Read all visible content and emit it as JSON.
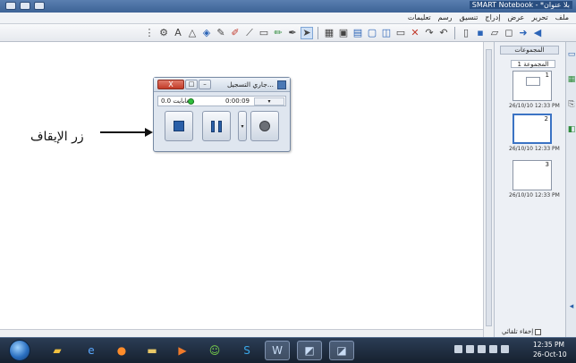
{
  "window": {
    "title": "SMART Notebook - *بلا عنوان"
  },
  "menu": {
    "items": [
      "ملف",
      "تحرير",
      "عرض",
      "إدراج",
      "تنسيق",
      "رسم",
      "تعليمات"
    ]
  },
  "toolbar": {
    "tools": [
      "select-icon",
      "pen-icon",
      "creative-pen-icon",
      "eraser-icon",
      "line-icon",
      "shape-icon",
      "magic-pen-icon",
      "fill-icon",
      "text-icon",
      "table-icon",
      "screen-shade-icon",
      "undo-icon",
      "redo-icon",
      "delete-icon",
      "next-page-icon",
      "previous-page-icon"
    ]
  },
  "sidepane": {
    "header": "المجموعات",
    "group_label": "المجموعة 1",
    "pages": [
      {
        "number": "1",
        "date": "26/10/10 12:33 PM"
      },
      {
        "number": "2",
        "date": "26/10/10 12:33 PM"
      },
      {
        "number": "3",
        "date": "26/10/10 12:33 PM"
      }
    ],
    "autohide_label": "إخفاء تلقائي"
  },
  "recorder": {
    "title": "جاري التسجيل...",
    "close_label": "X",
    "file_size": "0.0 ميغابايت",
    "elapsed_time": "0:00:09",
    "buttons": {
      "stop": "stop-icon",
      "pause": "pause-icon",
      "record": "record-icon"
    }
  },
  "annotation": {
    "label": "زر الإيقاف"
  },
  "taskbar": {
    "clock_time": "12:35 PM",
    "clock_date": "26-Oct-10",
    "apps": [
      "windows-explorer-icon",
      "internet-explorer-icon",
      "firefox-icon",
      "folder-icon",
      "media-player-icon",
      "messenger-icon",
      "skype-icon",
      "word-icon",
      "smart-tool-icon",
      "smart-notebook-icon"
    ]
  },
  "colors": {
    "accent": "#2a5fa8",
    "record_led": "#2fbf3c"
  }
}
